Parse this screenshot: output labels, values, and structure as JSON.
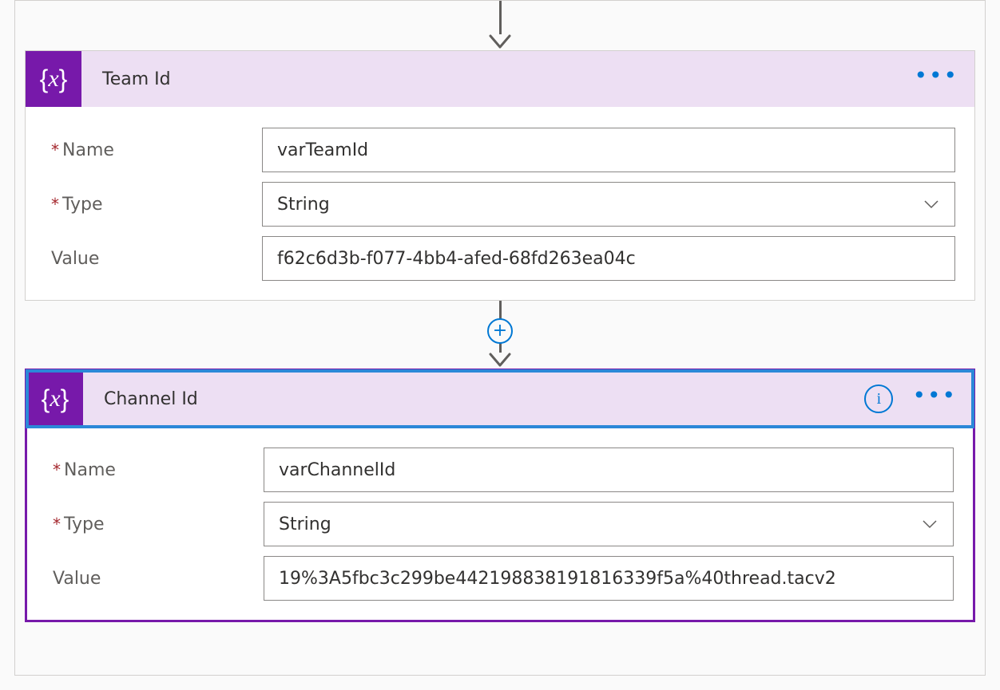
{
  "colors": {
    "accent": "#7719aa",
    "link": "#0078d4",
    "headerFill": "#eddff3",
    "selectedOutline": "#2b88d8"
  },
  "labels": {
    "name": "Name",
    "type": "Type",
    "value": "Value"
  },
  "cards": [
    {
      "title": "Team Id",
      "icon": "variable-icon",
      "selected": false,
      "fields": {
        "name": "varTeamId",
        "type": "String",
        "value": "f62c6d3b-f077-4bb4-afed-68fd263ea04c"
      }
    },
    {
      "title": "Channel Id",
      "icon": "variable-icon",
      "selected": true,
      "fields": {
        "name": "varChannelId",
        "type": "String",
        "value": "19%3A5fbc3c299be442198838191816339f5a%40thread.tacv2"
      }
    }
  ]
}
